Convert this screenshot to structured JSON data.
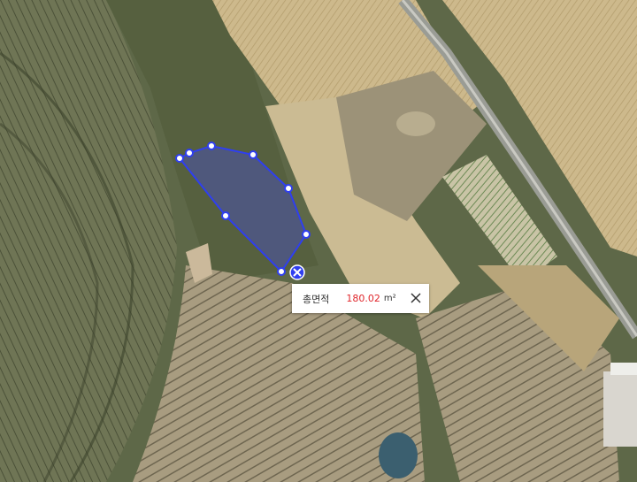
{
  "map": {
    "measurement": {
      "label": "총면적",
      "value": "180.02",
      "unit": "m²"
    },
    "polygon_color": "#2f3ff0",
    "value_color": "#e0262b",
    "vertex_count": 9
  },
  "icons": {
    "delete_marker": "delete-x-icon",
    "popup_close": "close-icon"
  }
}
